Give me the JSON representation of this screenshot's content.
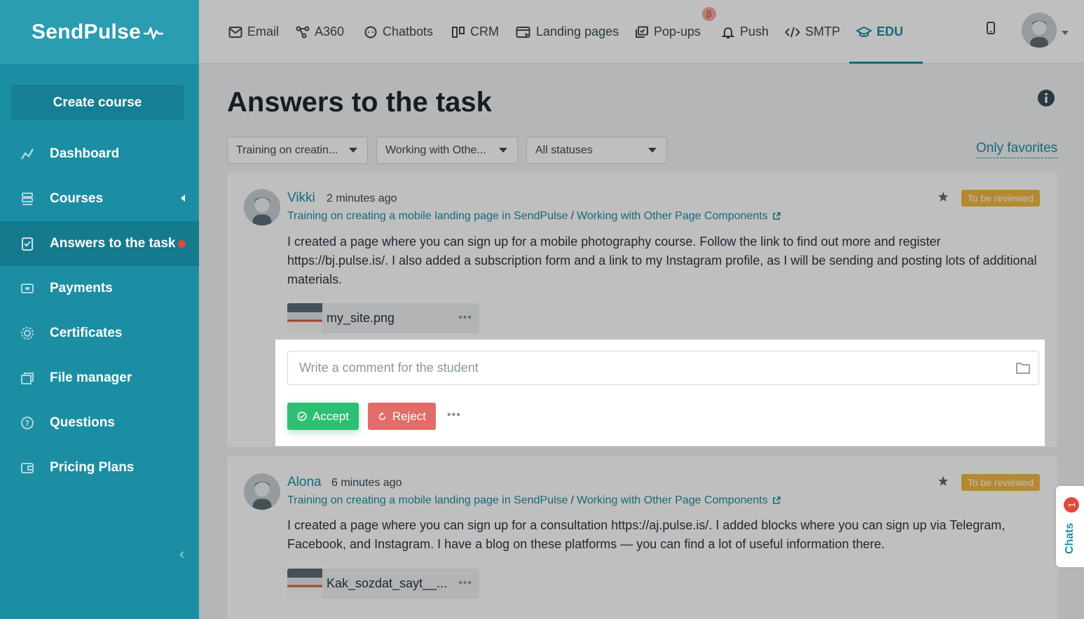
{
  "brand": {
    "name": "SendPulse"
  },
  "sidebar": {
    "create_label": "Create course",
    "items": [
      {
        "label": "Dashboard"
      },
      {
        "label": "Courses"
      },
      {
        "label": "Answers to the task"
      },
      {
        "label": "Payments"
      },
      {
        "label": "Certificates"
      },
      {
        "label": "File manager"
      },
      {
        "label": "Questions"
      },
      {
        "label": "Pricing Plans"
      }
    ],
    "collapse_glyph": "‹"
  },
  "topnav": {
    "items": [
      {
        "label": "Email"
      },
      {
        "label": "A360"
      },
      {
        "label": "Chatbots"
      },
      {
        "label": "CRM"
      },
      {
        "label": "Landing pages"
      },
      {
        "label": "Pop-ups"
      },
      {
        "label": "Push"
      },
      {
        "label": "SMTP"
      },
      {
        "label": "EDU"
      }
    ],
    "beta_badge": "β",
    "active": "EDU"
  },
  "page": {
    "title": "Answers to the task",
    "filters": {
      "course": "Training on creatin...",
      "lesson": "Working with Othe...",
      "status": "All statuses"
    },
    "favorites_link": "Only favorites"
  },
  "answers": [
    {
      "student": "Vikki",
      "time": "2 minutes ago",
      "course": "Training on creating a mobile landing page in SendPulse",
      "lesson": "Working with Other Page Components",
      "status": "To be reviewed",
      "text": "I created a page where you can sign up for a mobile photography course. Follow the link to find out more and register https://bj.pulse.is/. I also added a subscription form and a link to my Instagram profile, as I will be sending and posting lots of additional materials.",
      "file": "my_site.png"
    },
    {
      "student": "Alona",
      "time": "6 minutes ago",
      "course": "Training on creating a mobile landing page in SendPulse",
      "lesson": "Working with Other Page Components",
      "status": "To be reviewed",
      "text": "I created a page where you can sign up for a consultation https://aj.pulse.is/. I added blocks where you can sign up via Telegram, Facebook, and Instagram. I have a blog on these platforms — you can find a lot of useful information there.",
      "file": "Kak_sozdat_sayt__..."
    }
  ],
  "comment": {
    "placeholder": "Write a comment for the student",
    "accept_label": "Accept",
    "reject_label": "Reject",
    "more_glyph": "•••"
  },
  "chats": {
    "label": "Chats",
    "count": "1"
  },
  "colors": {
    "brand": "#1c8ea3",
    "accept": "#2ebf72",
    "reject": "#e26c6a",
    "status_badge": "#f0b740",
    "notification": "#e04a3a"
  }
}
